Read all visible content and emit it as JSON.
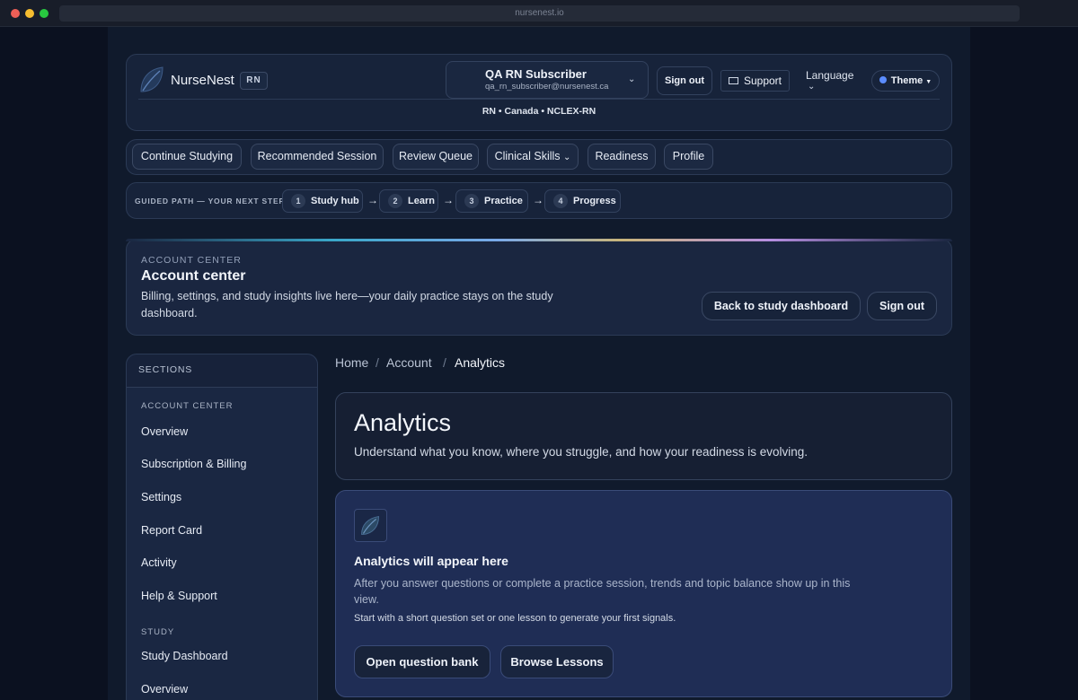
{
  "browser": {
    "url": "nursenest.io"
  },
  "header": {
    "brand": "NurseNest",
    "badge": "RN",
    "account": {
      "name": "QA RN Subscriber",
      "email": "qa_rn_subscriber@nursenest.ca"
    },
    "sign_out": "Sign out",
    "support": "Support",
    "language": "Language",
    "theme": "Theme",
    "meta": "RN • Canada • NCLEX-RN"
  },
  "nav": {
    "items": [
      {
        "label": "Continue Studying"
      },
      {
        "label": "Recommended Session"
      },
      {
        "label": "Review Queue"
      },
      {
        "label": "Clinical Skills"
      },
      {
        "label": "Readiness"
      },
      {
        "label": "Profile"
      }
    ]
  },
  "guided": {
    "label": "GUIDED PATH — YOUR NEXT STEP",
    "steps": [
      {
        "num": "1",
        "label": "Study hub"
      },
      {
        "num": "2",
        "label": "Learn"
      },
      {
        "num": "3",
        "label": "Practice"
      },
      {
        "num": "4",
        "label": "Progress"
      }
    ],
    "arrow": "→"
  },
  "banner": {
    "eyebrow": "ACCOUNT CENTER",
    "title": "Account center",
    "description": "Billing, settings, and study insights live here—your daily practice stays on the study dashboard.",
    "back_button": "Back to study dashboard",
    "sign_out": "Sign out"
  },
  "sidebar": {
    "heading": "SECTIONS",
    "groups": [
      {
        "title": "ACCOUNT CENTER",
        "items": [
          "Overview",
          "Subscription & Billing",
          "Settings",
          "Report Card",
          "Activity",
          "Help & Support"
        ]
      },
      {
        "title": "STUDY",
        "items": [
          "Study Dashboard",
          "Overview"
        ]
      }
    ]
  },
  "breadcrumb": {
    "items": [
      "Home",
      "Account",
      "Analytics"
    ],
    "separator": "/"
  },
  "main": {
    "title": "Analytics",
    "subtitle": "Understand what you know, where you struggle, and how your readiness is evolving.",
    "empty": {
      "title": "Analytics will appear here",
      "description": "After you answer questions or complete a practice session, trends and topic balance show up in this view.",
      "hint": "Start with a short question set or one lesson to generate your first signals.",
      "primary_cta": "Open question bank",
      "secondary_cta": "Browse Lessons"
    }
  },
  "icons": {
    "logo": "leaf-icon",
    "support": "envelope-icon",
    "chevron": "chevron-down-icon"
  },
  "colors": {
    "accent": "#5b8cff",
    "background": "#0c1322",
    "panel": "#17233a",
    "empty_card": "#1f2d55"
  }
}
